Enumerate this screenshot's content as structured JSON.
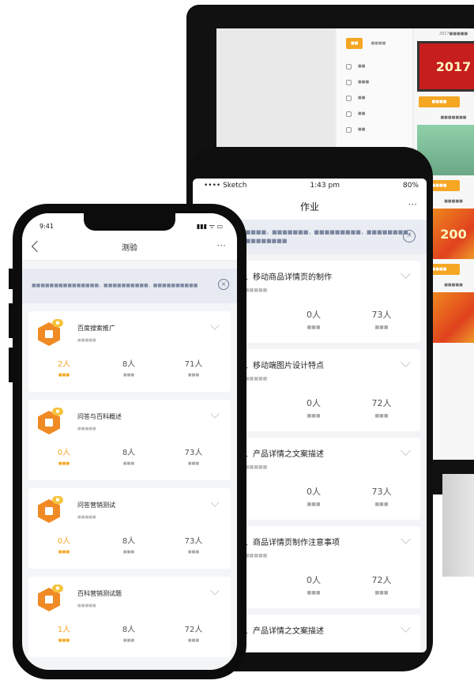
{
  "monitor": {
    "tabs": [
      "■■",
      "■■■■"
    ],
    "nav": [
      "■■",
      "■■■",
      "■■",
      "■■",
      "■■"
    ],
    "promos": [
      {
        "caption": "2017■■■■■",
        "text": "2017",
        "button": "■■■■"
      },
      {
        "caption": "■■■■■■■",
        "text": "",
        "button": "■■■■"
      },
      {
        "caption": "■■■■■",
        "text": "200",
        "button": "■■■■"
      },
      {
        "caption": "■■■■■",
        "text": "",
        "button": "■■■■"
      }
    ]
  },
  "android": {
    "status": {
      "carrier": "•••• Sketch",
      "time": "1:43 pm",
      "battery": "80%"
    },
    "title": "作业",
    "more": "···",
    "notice": "■■■■■，■■■■■■■，■■■■■■■■■，■■■■■■■■，■■■■■■■■■",
    "items": [
      {
        "title": "、移动商品详情页的制作",
        "sub": "■■■■■",
        "a": "0人",
        "a_label": "■■■",
        "b": "73人",
        "b_label": "■■■"
      },
      {
        "title": "、移动端图片设计特点",
        "sub": "■■■■■",
        "a": "0人",
        "a_label": "■■■",
        "b": "72人",
        "b_label": "■■■"
      },
      {
        "title": "、产品详情之文案描述",
        "sub": "■■■■■",
        "a": "0人",
        "a_label": "■■■",
        "b": "73人",
        "b_label": "■■■"
      },
      {
        "title": "、商品详情页制作注意事项",
        "sub": "■■■■■",
        "a": "0人",
        "a_label": "■■■",
        "b": "72人",
        "b_label": "■■■"
      },
      {
        "title": "、产品详情之文案描述",
        "sub": "",
        "a": "",
        "a_label": "",
        "b": "",
        "b_label": ""
      }
    ]
  },
  "iphone": {
    "status": {
      "time": "9:41",
      "signal": "▮▮▮ ᯤ ▭"
    },
    "title": "测验",
    "more": "···",
    "notice": "■■■■■■■■■■■■■■■，■■■■■■■■■■，■■■■■■■■■■",
    "items": [
      {
        "badge": "■",
        "title": "百度搜索推广",
        "sub": "■■■■■",
        "s1": "2人",
        "s1_label": "■■■",
        "s2": "8人",
        "s2_label": "■■■",
        "s3": "71人",
        "s3_label": "■■■"
      },
      {
        "badge": "■",
        "title": "问答与百科概述",
        "sub": "■■■■■",
        "s1": "0人",
        "s1_label": "■■■",
        "s2": "8人",
        "s2_label": "■■■",
        "s3": "73人",
        "s3_label": "■■■"
      },
      {
        "badge": "■",
        "title": "问答营销测试",
        "sub": "■■■■■",
        "s1": "0人",
        "s1_label": "■■■",
        "s2": "8人",
        "s2_label": "■■■",
        "s3": "73人",
        "s3_label": "■■■"
      },
      {
        "badge": "■",
        "title": "百科营销测试题",
        "sub": "■■■■■",
        "s1": "1人",
        "s1_label": "■■■",
        "s2": "8人",
        "s2_label": "■■■",
        "s3": "72人",
        "s3_label": "■■■"
      }
    ]
  },
  "colors": {
    "accent": "#f5a623",
    "hex_icon": "#f08a24",
    "background": "#f4f5f7"
  }
}
